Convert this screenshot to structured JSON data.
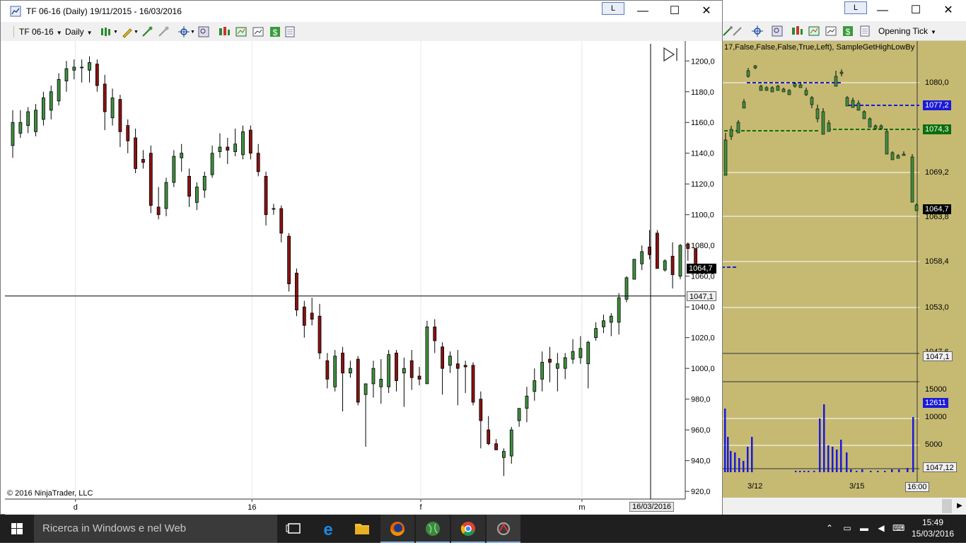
{
  "front_window": {
    "title": "TF 06-16 (Daily)  19/11/2015 - 16/03/2016",
    "link_label": "L",
    "minimize": "—",
    "maximize": "☐",
    "close": "✕",
    "toolbar": {
      "instrument": "TF 06-16",
      "interval": "Daily"
    },
    "copyright": "© 2016 NinjaTrader, LLC",
    "current_price_tag": "1064,7",
    "crosshair_price_tag": "1047,1",
    "crosshair_date_tag": "16/03/2016"
  },
  "back_window": {
    "link_label": "L",
    "minimize": "—",
    "maximize": "☐",
    "close": "✕",
    "toolbar_dropdown": "Opening Tick",
    "indicator_label": "17,False,False,False,True,Left), SampleGetHighLowBy",
    "price_ticks": [
      "1080,0",
      "1069,2",
      "1063,8",
      "1058,4",
      "1053,0",
      "1047,6"
    ],
    "price_tags": [
      {
        "label": "1077,2",
        "color": "#1a1ad8"
      },
      {
        "label": "1074,3",
        "color": "#0a6e0a"
      },
      {
        "label": "1064,7",
        "color": "#000000"
      },
      {
        "label": "1047,1",
        "color": "#f0f0f0"
      }
    ],
    "volume_ticks": [
      "15000",
      "10000",
      "5000"
    ],
    "volume_tag": "12611",
    "volume_crosshair_tag": "1047,12",
    "time_labels": [
      "3/12",
      "3/15",
      "16:00"
    ]
  },
  "taskbar": {
    "search_placeholder": "Ricerca in Windows e nel Web",
    "time": "15:49",
    "date": "15/03/2016"
  },
  "chart_data": {
    "type": "candlestick",
    "instrument": "TF 06-16",
    "interval": "Daily",
    "y_ticks": [
      920,
      940,
      960,
      980,
      1000,
      1020,
      1040,
      1060,
      1080,
      1100,
      1120,
      1140,
      1160,
      1180,
      1200
    ],
    "y_tick_labels": [
      "920,0",
      "940,0",
      "960,0",
      "980,0",
      "1000,0",
      "1020,0",
      "1040,0",
      "1060,0",
      "1080,0",
      "1100,0",
      "1120,0",
      "1140,0",
      "1160,0",
      "1180,0",
      "1200,0"
    ],
    "ylim": [
      915,
      1213
    ],
    "x_labels": [
      {
        "label": "d",
        "index": 8
      },
      {
        "label": "16",
        "index": 31
      },
      {
        "label": "f",
        "index": 53
      },
      {
        "label": "m",
        "index": 74
      }
    ],
    "crosshair_price": 1047.1,
    "last_price": 1064.7,
    "candles": [
      {
        "o": 1145,
        "h": 1168,
        "l": 1137,
        "c": 1160
      },
      {
        "o": 1153,
        "h": 1168,
        "l": 1150,
        "c": 1160
      },
      {
        "o": 1158,
        "h": 1170,
        "l": 1153,
        "c": 1167
      },
      {
        "o": 1154,
        "h": 1172,
        "l": 1151,
        "c": 1168
      },
      {
        "o": 1162,
        "h": 1180,
        "l": 1158,
        "c": 1176
      },
      {
        "o": 1168,
        "h": 1184,
        "l": 1162,
        "c": 1180
      },
      {
        "o": 1174,
        "h": 1192,
        "l": 1171,
        "c": 1188
      },
      {
        "o": 1187,
        "h": 1200,
        "l": 1180,
        "c": 1195
      },
      {
        "o": 1194,
        "h": 1201,
        "l": 1188,
        "c": 1196
      },
      {
        "o": 1196,
        "h": 1201,
        "l": 1186,
        "c": 1196
      },
      {
        "o": 1194,
        "h": 1203,
        "l": 1186,
        "c": 1199
      },
      {
        "o": 1198,
        "h": 1201,
        "l": 1180,
        "c": 1184
      },
      {
        "o": 1185,
        "h": 1191,
        "l": 1155,
        "c": 1167
      },
      {
        "o": 1163,
        "h": 1182,
        "l": 1158,
        "c": 1176
      },
      {
        "o": 1175,
        "h": 1178,
        "l": 1144,
        "c": 1154
      },
      {
        "o": 1158,
        "h": 1162,
        "l": 1140,
        "c": 1148
      },
      {
        "o": 1150,
        "h": 1156,
        "l": 1127,
        "c": 1130
      },
      {
        "o": 1136,
        "h": 1142,
        "l": 1130,
        "c": 1134
      },
      {
        "o": 1140,
        "h": 1145,
        "l": 1101,
        "c": 1106
      },
      {
        "o": 1105,
        "h": 1118,
        "l": 1097,
        "c": 1100
      },
      {
        "o": 1104,
        "h": 1124,
        "l": 1099,
        "c": 1121
      },
      {
        "o": 1121,
        "h": 1142,
        "l": 1118,
        "c": 1138
      },
      {
        "o": 1137,
        "h": 1146,
        "l": 1128,
        "c": 1140
      },
      {
        "o": 1125,
        "h": 1130,
        "l": 1105,
        "c": 1112
      },
      {
        "o": 1108,
        "h": 1121,
        "l": 1103,
        "c": 1118
      },
      {
        "o": 1116,
        "h": 1128,
        "l": 1111,
        "c": 1125
      },
      {
        "o": 1126,
        "h": 1145,
        "l": 1124,
        "c": 1140
      },
      {
        "o": 1141,
        "h": 1153,
        "l": 1137,
        "c": 1144
      },
      {
        "o": 1144,
        "h": 1150,
        "l": 1133,
        "c": 1142
      },
      {
        "o": 1141,
        "h": 1156,
        "l": 1138,
        "c": 1146
      },
      {
        "o": 1139,
        "h": 1158,
        "l": 1136,
        "c": 1154
      },
      {
        "o": 1155,
        "h": 1158,
        "l": 1136,
        "c": 1140
      },
      {
        "o": 1140,
        "h": 1146,
        "l": 1125,
        "c": 1128
      },
      {
        "o": 1125,
        "h": 1128,
        "l": 1093,
        "c": 1100
      },
      {
        "o": 1104,
        "h": 1107,
        "l": 1100,
        "c": 1104
      },
      {
        "o": 1104,
        "h": 1106,
        "l": 1082,
        "c": 1088
      },
      {
        "o": 1086,
        "h": 1088,
        "l": 1050,
        "c": 1055
      },
      {
        "o": 1062,
        "h": 1065,
        "l": 1034,
        "c": 1038
      },
      {
        "o": 1040,
        "h": 1044,
        "l": 1020,
        "c": 1028
      },
      {
        "o": 1036,
        "h": 1046,
        "l": 1028,
        "c": 1032
      },
      {
        "o": 1034,
        "h": 1042,
        "l": 1006,
        "c": 1010
      },
      {
        "o": 1005,
        "h": 1010,
        "l": 987,
        "c": 993
      },
      {
        "o": 988,
        "h": 1012,
        "l": 985,
        "c": 1008
      },
      {
        "o": 1010,
        "h": 1014,
        "l": 972,
        "c": 997
      },
      {
        "o": 997,
        "h": 1005,
        "l": 994,
        "c": 1000
      },
      {
        "o": 1006,
        "h": 1008,
        "l": 976,
        "c": 978
      },
      {
        "o": 983,
        "h": 990,
        "l": 949,
        "c": 990
      },
      {
        "o": 990,
        "h": 1005,
        "l": 981,
        "c": 1000
      },
      {
        "o": 988,
        "h": 1006,
        "l": 977,
        "c": 993
      },
      {
        "o": 988,
        "h": 1012,
        "l": 984,
        "c": 1009
      },
      {
        "o": 1010,
        "h": 1012,
        "l": 985,
        "c": 992
      },
      {
        "o": 997,
        "h": 1007,
        "l": 975,
        "c": 1000
      },
      {
        "o": 1005,
        "h": 1012,
        "l": 986,
        "c": 994
      },
      {
        "o": 995,
        "h": 1001,
        "l": 989,
        "c": 993
      },
      {
        "o": 990,
        "h": 1031,
        "l": 990,
        "c": 1027
      },
      {
        "o": 1027,
        "h": 1032,
        "l": 1010,
        "c": 1018
      },
      {
        "o": 1014,
        "h": 1017,
        "l": 983,
        "c": 1000
      },
      {
        "o": 1002,
        "h": 1011,
        "l": 997,
        "c": 1008
      },
      {
        "o": 1003,
        "h": 1012,
        "l": 976,
        "c": 1000
      },
      {
        "o": 1002,
        "h": 1005,
        "l": 984,
        "c": 1001
      },
      {
        "o": 1002,
        "h": 1004,
        "l": 976,
        "c": 978
      },
      {
        "o": 980,
        "h": 985,
        "l": 948,
        "c": 966
      },
      {
        "o": 960,
        "h": 969,
        "l": 950,
        "c": 951
      },
      {
        "o": 951,
        "h": 954,
        "l": 947,
        "c": 947
      },
      {
        "o": 942,
        "h": 948,
        "l": 930,
        "c": 946
      },
      {
        "o": 943,
        "h": 962,
        "l": 938,
        "c": 960
      },
      {
        "o": 966,
        "h": 974,
        "l": 962,
        "c": 974
      },
      {
        "o": 974,
        "h": 988,
        "l": 965,
        "c": 982
      },
      {
        "o": 985,
        "h": 1000,
        "l": 979,
        "c": 992
      },
      {
        "o": 993,
        "h": 1011,
        "l": 985,
        "c": 1004
      },
      {
        "o": 1006,
        "h": 1014,
        "l": 991,
        "c": 1004
      },
      {
        "o": 1000,
        "h": 1010,
        "l": 985,
        "c": 1003
      },
      {
        "o": 1000,
        "h": 1010,
        "l": 993,
        "c": 1007
      },
      {
        "o": 1006,
        "h": 1019,
        "l": 1003,
        "c": 1011
      },
      {
        "o": 1007,
        "h": 1021,
        "l": 1003,
        "c": 1013
      },
      {
        "o": 1003,
        "h": 1018,
        "l": 987,
        "c": 1017
      },
      {
        "o": 1020,
        "h": 1030,
        "l": 1018,
        "c": 1026
      },
      {
        "o": 1027,
        "h": 1035,
        "l": 1023,
        "c": 1031
      },
      {
        "o": 1030,
        "h": 1036,
        "l": 1021,
        "c": 1034
      },
      {
        "o": 1030,
        "h": 1049,
        "l": 1022,
        "c": 1046
      },
      {
        "o": 1045,
        "h": 1060,
        "l": 1043,
        "c": 1059
      },
      {
        "o": 1058,
        "h": 1071,
        "l": 1058,
        "c": 1071
      },
      {
        "o": 1068,
        "h": 1080,
        "l": 1064,
        "c": 1076
      },
      {
        "o": 1079,
        "h": 1090,
        "l": 1071,
        "c": 1074
      },
      {
        "o": 1088,
        "h": 1090,
        "l": 1067,
        "c": 1065
      },
      {
        "o": 1064,
        "h": 1071,
        "l": 1063,
        "c": 1070
      },
      {
        "o": 1073,
        "h": 1082,
        "l": 1052,
        "c": 1061
      },
      {
        "o": 1060,
        "h": 1081,
        "l": 1058,
        "c": 1080
      },
      {
        "o": 1081,
        "h": 1082,
        "l": 1070,
        "c": 1078
      },
      {
        "o": 1078,
        "h": 1078,
        "l": 1064.7,
        "c": 1064.7
      }
    ]
  }
}
